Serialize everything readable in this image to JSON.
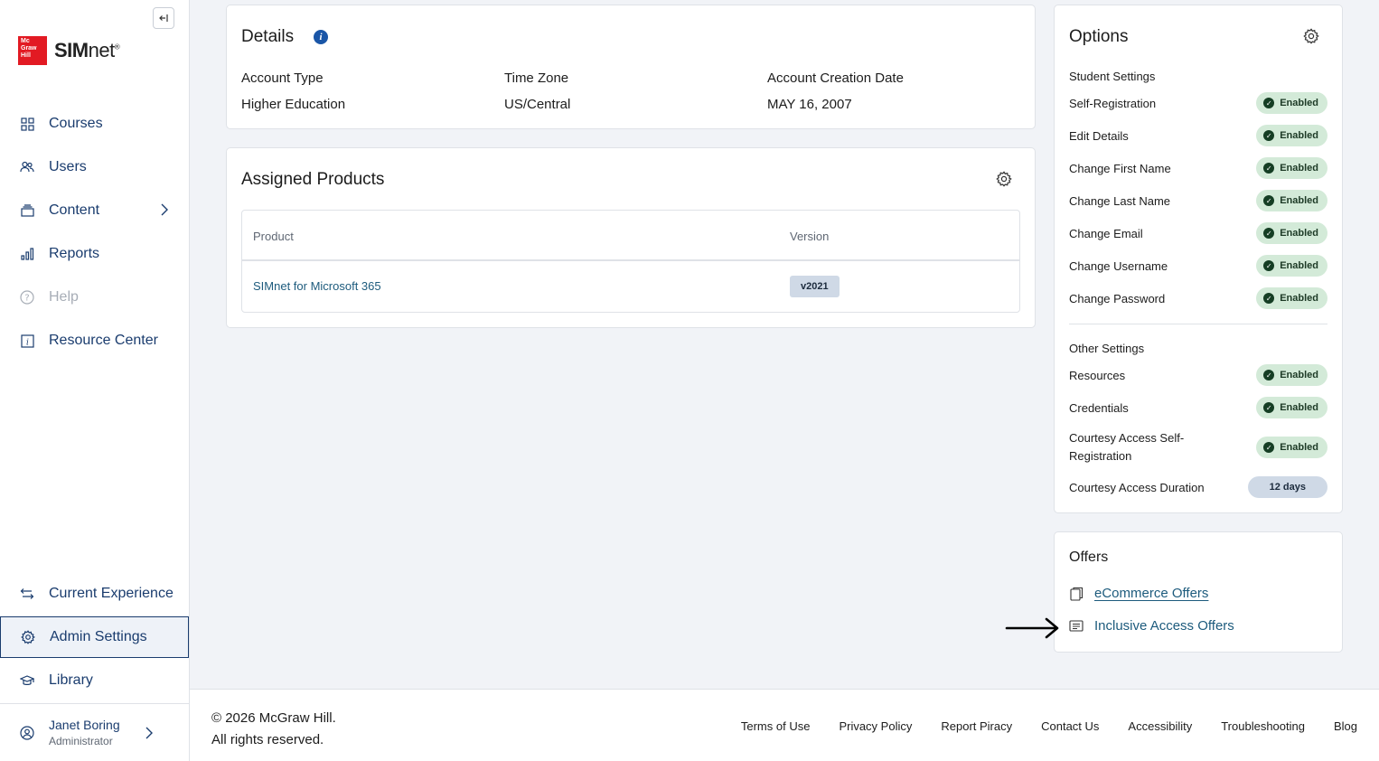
{
  "brand": {
    "logo_box_text": "Mc Graw Hill",
    "product_bold": "SIM",
    "product_rest": "net",
    "trademark": "®"
  },
  "sidebar": {
    "items": [
      {
        "label": "Courses",
        "icon": "grid-icon"
      },
      {
        "label": "Users",
        "icon": "users-icon"
      },
      {
        "label": "Content",
        "icon": "layers-icon"
      },
      {
        "label": "Reports",
        "icon": "bar-chart-icon"
      },
      {
        "label": "Help",
        "icon": "question-icon"
      },
      {
        "label": "Resource Center",
        "icon": "info-icon"
      }
    ],
    "bottom_items": [
      {
        "label": "Current Experience",
        "icon": "switch-arrows-icon"
      },
      {
        "label": "Admin Settings",
        "icon": "gear-icon"
      },
      {
        "label": "Library",
        "icon": "graduation-cap-icon"
      }
    ],
    "user": {
      "name": "Janet Boring",
      "role": "Administrator"
    }
  },
  "details": {
    "title": "Details",
    "fields": [
      {
        "label": "Account Type",
        "value": "Higher Education"
      },
      {
        "label": "Time Zone",
        "value": "US/Central"
      },
      {
        "label": "Account Creation Date",
        "value": "MAY 16, 2007"
      }
    ]
  },
  "products": {
    "title": "Assigned Products",
    "columns": [
      "Product",
      "Version"
    ],
    "rows": [
      {
        "product": "SIMnet for Microsoft 365",
        "version": "v2021"
      }
    ]
  },
  "options": {
    "title": "Options",
    "student_settings": {
      "heading": "Student Settings",
      "rows": [
        {
          "label": "Self-Registration",
          "status": "Enabled"
        },
        {
          "label": "Edit Details",
          "status": "Enabled"
        },
        {
          "label": "Change First Name",
          "status": "Enabled"
        },
        {
          "label": "Change Last Name",
          "status": "Enabled"
        },
        {
          "label": "Change Email",
          "status": "Enabled"
        },
        {
          "label": "Change Username",
          "status": "Enabled"
        },
        {
          "label": "Change Password",
          "status": "Enabled"
        }
      ]
    },
    "other_settings": {
      "heading": "Other Settings",
      "rows": [
        {
          "label": "Resources",
          "status": "Enabled"
        },
        {
          "label": "Credentials",
          "status": "Enabled"
        },
        {
          "label": "Courtesy Access Self-Registration",
          "status": "Enabled"
        },
        {
          "label": "Courtesy Access Duration",
          "status": "12 days"
        }
      ]
    }
  },
  "offers": {
    "title": "Offers",
    "links": [
      {
        "label": "eCommerce Offers",
        "icon": "copy-icon"
      },
      {
        "label": "Inclusive Access Offers",
        "icon": "document-icon"
      }
    ]
  },
  "footer": {
    "copyright_line1": "© 2026 McGraw Hill.",
    "copyright_line2": "All rights reserved.",
    "links": [
      "Terms of Use",
      "Privacy Policy",
      "Report Piracy",
      "Contact Us",
      "Accessibility",
      "Troubleshooting",
      "Blog"
    ]
  },
  "colors": {
    "nav_text": "#1a3c6e",
    "link": "#1d5b7d",
    "enabled_pill": "#d3ead8",
    "brand_red": "#e21a23"
  }
}
